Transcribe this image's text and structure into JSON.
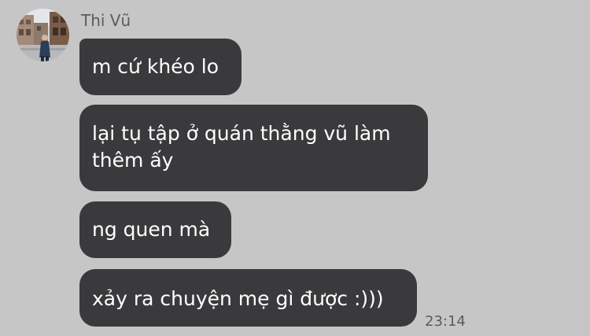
{
  "contact": {
    "name": "Thi Vũ"
  },
  "messages": [
    {
      "lines": [
        "m cứ khéo lo"
      ]
    },
    {
      "lines": [
        "lại tụ tập ở quán thằng vũ làm",
        "thêm ấy"
      ]
    },
    {
      "lines": [
        "ng quen mà"
      ]
    },
    {
      "lines": [
        "xảy ra chuyện mẹ gì được :)))"
      ]
    }
  ],
  "last_message_time": "23:14",
  "colors": {
    "background": "#c6c6c6",
    "bubble": "#3a3a3c",
    "bubble_text": "#ffffff",
    "meta_text": "#5c5c5c"
  },
  "icons": {
    "avatar": "profile-photo"
  }
}
